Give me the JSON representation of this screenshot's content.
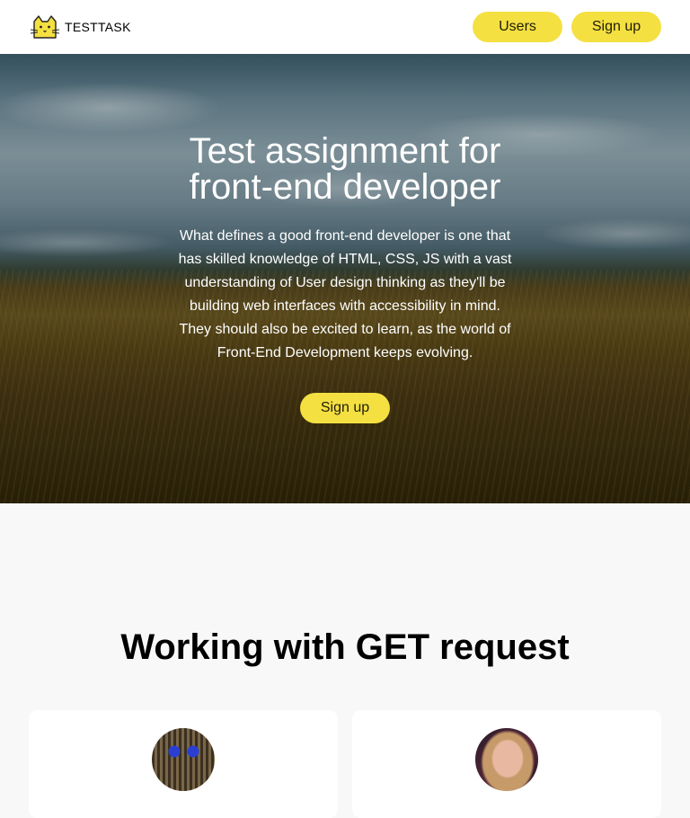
{
  "header": {
    "logo_text": "TESTTASK",
    "nav": {
      "users_label": "Users",
      "signup_label": "Sign up"
    }
  },
  "hero": {
    "title": "Test assignment for front-end developer",
    "text": "What defines a good front-end developer is one that has skilled knowledge of HTML, CSS, JS with a vast understanding of User design thinking as they'll be building web interfaces with accessibility in mind. They should also be excited to learn, as the world of Front-End Development keeps evolving.",
    "signup_label": "Sign up"
  },
  "users_section": {
    "title": "Working with GET request",
    "cards": [
      {
        "avatar_icon": "cat-photo"
      },
      {
        "avatar_icon": "person-photo"
      }
    ]
  },
  "colors": {
    "accent": "#f4e041",
    "background": "#f8f8f8",
    "card": "#ffffff"
  }
}
